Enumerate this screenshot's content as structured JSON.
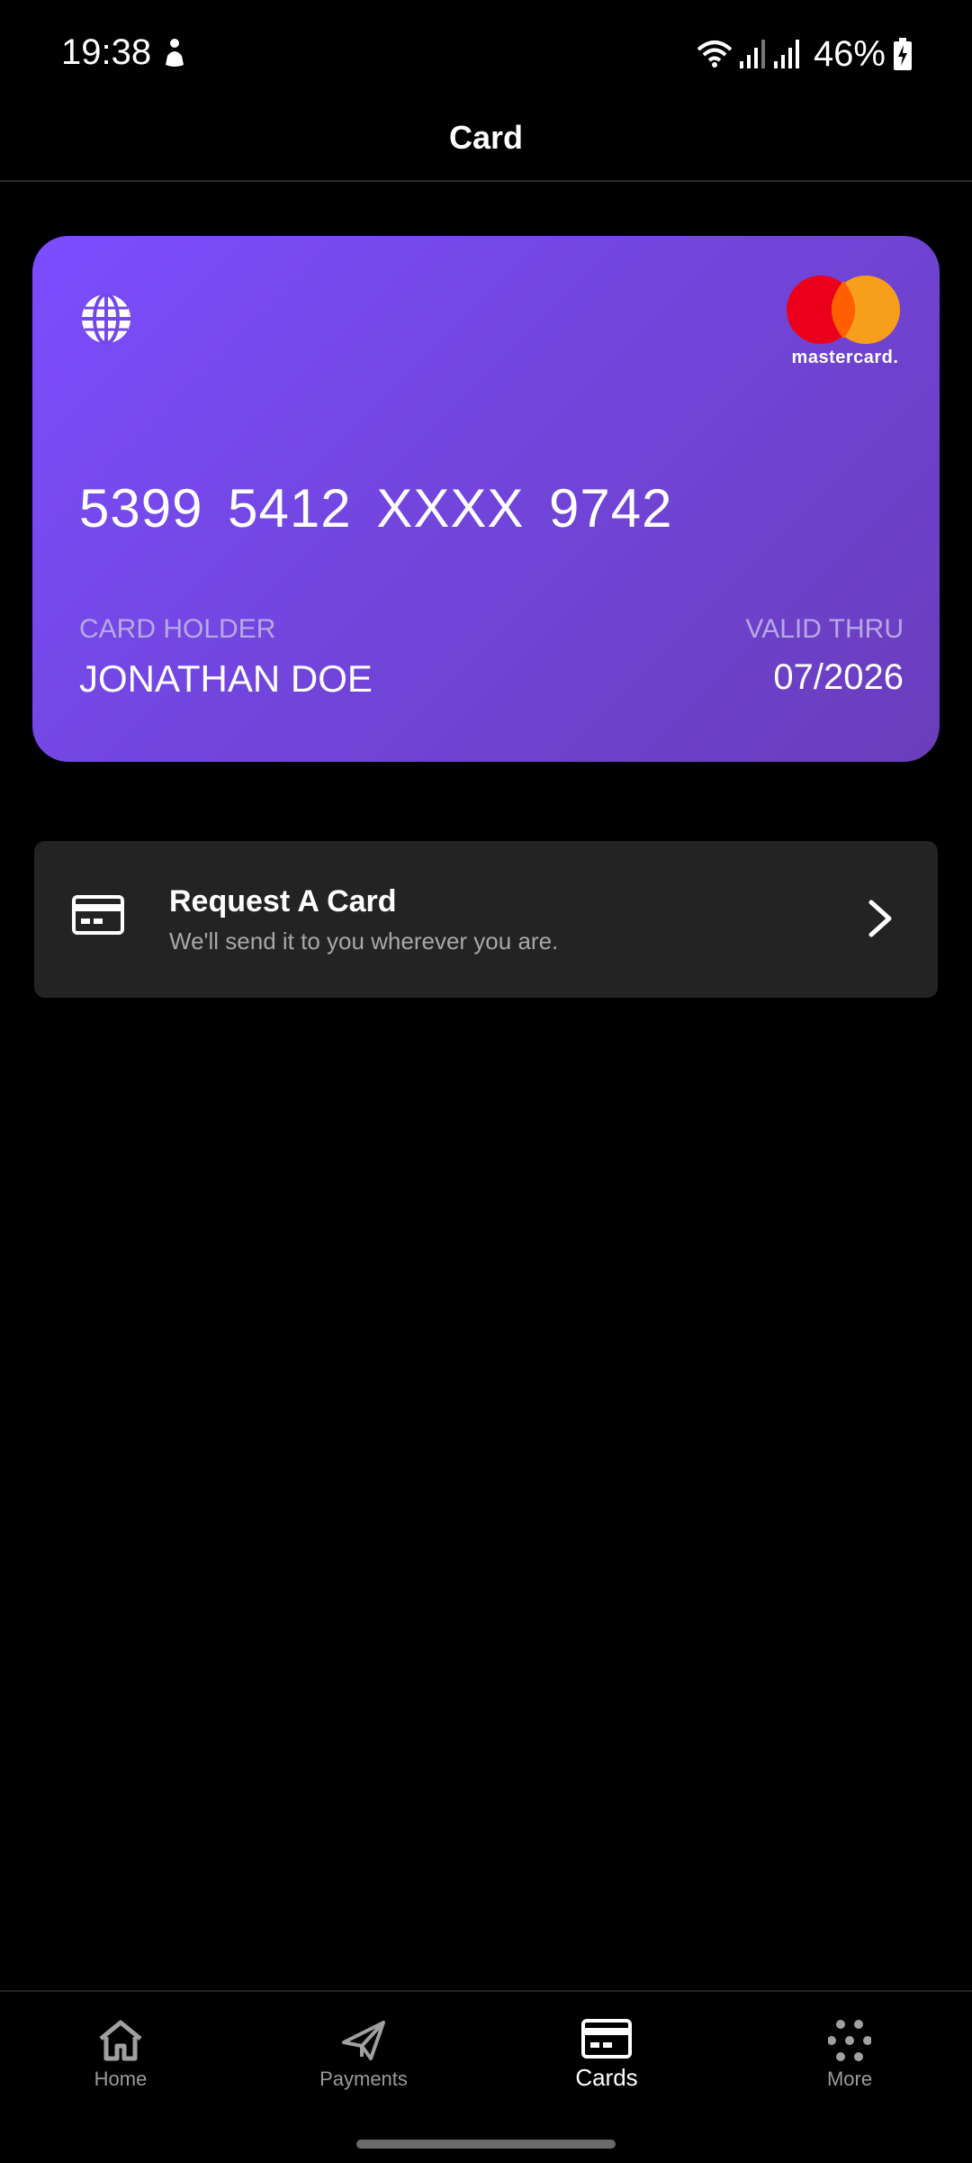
{
  "status_bar": {
    "time": "19:38",
    "battery": "46%",
    "icons": [
      "person-walking-icon",
      "wifi-icon",
      "signal-icon",
      "signal-icon",
      "battery-charging-icon"
    ]
  },
  "header": {
    "title": "Card"
  },
  "card": {
    "brand": "mastercard.",
    "number": "5399  5412  XXXX  9742",
    "holder_label": "CARD HOLDER",
    "holder_name": "JONATHAN DOE",
    "valid_label": "VALID THRU",
    "valid_value": "07/2026",
    "colors": {
      "gradient_start": "#7c4dff",
      "gradient_end": "#6a3dbb",
      "mc_red": "#eb001b",
      "mc_yellow": "#f79e1b"
    }
  },
  "request_card": {
    "title": "Request A Card",
    "subtitle": "We'll send it to you wherever you are.",
    "icon": "credit-card-icon"
  },
  "bottom_nav": {
    "items": [
      {
        "label": "Home",
        "icon": "home-icon",
        "active": false
      },
      {
        "label": "Payments",
        "icon": "paper-plane-icon",
        "active": false
      },
      {
        "label": "Cards",
        "icon": "credit-card-icon",
        "active": true
      },
      {
        "label": "More",
        "icon": "dots-grid-icon",
        "active": false
      }
    ]
  }
}
